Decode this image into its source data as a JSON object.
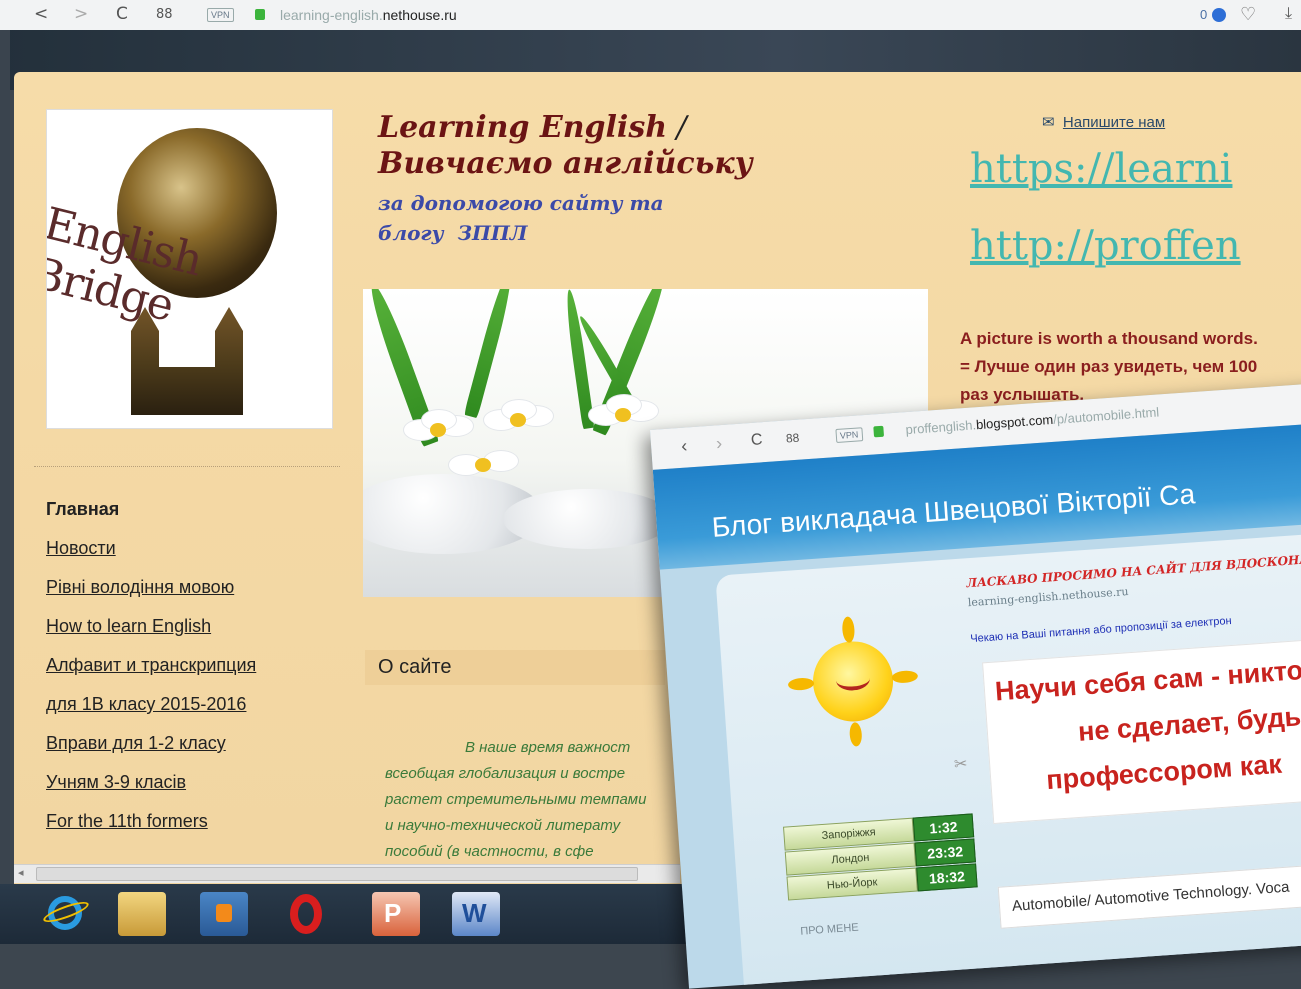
{
  "browser": {
    "back": "<",
    "forward": ">",
    "reload": "C",
    "grid": "88",
    "vpn": "VPN",
    "url_domain_pre": "learning-english.",
    "url_domain_main": "nethouse.ru",
    "right_counter": "0"
  },
  "header": {
    "title_line1": "Learning English",
    "title_slash": " /",
    "title_line2": "Вивчаємо англійську",
    "sub_line1": "за допомогою сайту та",
    "sub_line2_a": "блогу",
    "sub_line2_b": "ЗППЛ",
    "contact_label": "Напишите нам",
    "link1": "https://learni",
    "link2": "http://proffen"
  },
  "logo": {
    "text": "English Bridge"
  },
  "menu": {
    "items": [
      "Главная",
      "Новости",
      "Рівні володіння мовою",
      "How to learn English",
      "Алфавит и транскрипция",
      "для 1В класу 2015-2016",
      "Вправи для 1-2 класу",
      "Учням 3-9 класів",
      "For the 11th formers"
    ]
  },
  "quote": {
    "en": "A picture is worth a thousand words.",
    "ru": "= Лучше один раз увидеть, чем 100 раз услышать."
  },
  "about": {
    "title": "О сайте",
    "lines": [
      "В наше время важност",
      "всеобщая глобализация и востре",
      "растет стремительными темпами",
      "и научно-технической литерату",
      "пособий (в частности, в сфе"
    ]
  },
  "blog": {
    "url_pre": "proffenglish.",
    "url_main": "blogspot.com",
    "url_post": "/p/automobile.html",
    "title": "Блог викладача Швецової Вікторії Са",
    "welcome": "ЛАСКАВО ПРОСИМО НА САЙТ ДЛЯ ВДОСКОНА",
    "site_link": "learning-english.nethouse.ru",
    "wait": "Чекаю на Ваші питання або пропозиції за електрон",
    "poster_lines": [
      "Научи себя сам - никто",
      "не сделает, будь",
      "профессором как"
    ],
    "clocks": [
      {
        "city": "Запоріжжя",
        "time": "1:32"
      },
      {
        "city": "Лондон",
        "time": "23:32"
      },
      {
        "city": "Нью-Йорк",
        "time": "18:32"
      }
    ],
    "about_me": "ПРО МЕНЕ",
    "post_title": "Automobile/ Automotive Technology. Voca"
  },
  "taskbar": {
    "icons": [
      "ie-icon",
      "explorer-icon",
      "media-player-icon",
      "opera-icon",
      "powerpoint-icon",
      "word-icon"
    ],
    "ppt_letter": "P",
    "word_letter": "W"
  },
  "colors": {
    "page_bg": "#f4d9a5",
    "title": "#6b1414",
    "link": "#43b7b0",
    "quote": "#8a1e1e"
  }
}
